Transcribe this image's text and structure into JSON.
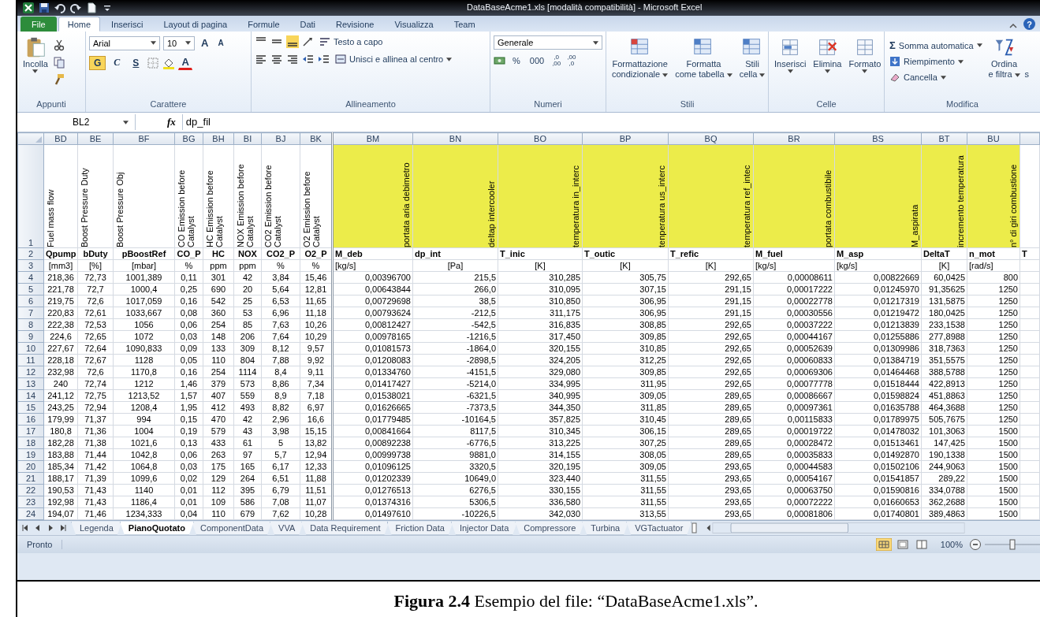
{
  "window": {
    "title": "DataBaseAcme1.xls  [modalità compatibilità]  -  Microsoft Excel"
  },
  "ribbon": {
    "tabs": [
      {
        "label": "File",
        "selected": false,
        "kind": "file"
      },
      {
        "label": "Home",
        "selected": true,
        "kind": "tab"
      },
      {
        "label": "Inserisci",
        "selected": false,
        "kind": "tab"
      },
      {
        "label": "Layout di pagina",
        "selected": false,
        "kind": "tab"
      },
      {
        "label": "Formule",
        "selected": false,
        "kind": "tab"
      },
      {
        "label": "Dati",
        "selected": false,
        "kind": "tab"
      },
      {
        "label": "Revisione",
        "selected": false,
        "kind": "tab"
      },
      {
        "label": "Visualizza",
        "selected": false,
        "kind": "tab"
      },
      {
        "label": "Team",
        "selected": false,
        "kind": "tab"
      }
    ],
    "help": "?",
    "clipboard": {
      "paste": "Incolla",
      "label": "Appunti"
    },
    "font": {
      "name": "Arial",
      "size": "10",
      "grow": "A",
      "shrink": "A",
      "bold": "G",
      "italic": "C",
      "underline": "S",
      "fontcolor": "A",
      "label": "Carattere"
    },
    "alignment": {
      "wrap": "Testo a capo",
      "merge": "Unisci e allinea al centro",
      "label": "Allineamento"
    },
    "number": {
      "format": "Generale",
      "percent": "%",
      "thousands": "000",
      "increase": [
        ",0",
        ",00"
      ],
      "decrease": [
        ",00",
        ",0"
      ],
      "label": "Numeri"
    },
    "styles": {
      "buttons": [
        {
          "lines": [
            "Formattazione",
            "condizionale"
          ]
        },
        {
          "lines": [
            "Formatta",
            "come tabella"
          ]
        },
        {
          "lines": [
            "Stili",
            "cella"
          ]
        }
      ],
      "label": "Stili"
    },
    "cells": {
      "buttons": [
        "Inserisci",
        "Elimina",
        "Formato"
      ],
      "label": "Celle"
    },
    "editing": {
      "sigma": "Σ",
      "autosum": "Somma automatica",
      "fill": "Riempimento",
      "clear": "Cancella",
      "sort": [
        "Ordina",
        "e filtra"
      ],
      "cut": "s",
      "label": "Modifica"
    }
  },
  "formula_bar": {
    "name_box": "BL2",
    "fx": "fx",
    "formula": "dp_fil"
  },
  "sheet": {
    "header_row_numbers": [
      "1",
      "2",
      "3"
    ],
    "columns": [
      {
        "letter": "BD",
        "title": "Fuel mass flow",
        "name": "Qpump",
        "unit": "[mm3]",
        "highlighted": false
      },
      {
        "letter": "BE",
        "title": "Boost Pressure Duty",
        "name": "bDuty",
        "unit": "[%]",
        "highlighted": false
      },
      {
        "letter": "BF",
        "title": "Boost Pressure Obj",
        "name": "pBoostRef",
        "unit": "[mbar]",
        "highlighted": false
      },
      {
        "letter": "BG",
        "title": "CO Emission before Catalyst",
        "name": "CO_P",
        "unit": "%",
        "highlighted": false
      },
      {
        "letter": "BH",
        "title": "HC Emission before Catalyst",
        "name": "HC",
        "unit": "ppm",
        "highlighted": false
      },
      {
        "letter": "BI",
        "title": "NOX Emission before Catalyst",
        "name": "NOX",
        "unit": "ppm",
        "highlighted": false
      },
      {
        "letter": "BJ",
        "title": "CO2 Emission before Catalyst",
        "name": "CO2_P",
        "unit": "%",
        "highlighted": false
      },
      {
        "letter": "BK",
        "title": "O2 Emission before Catalyst",
        "name": "O2_P",
        "unit": "%",
        "highlighted": false
      },
      {
        "letter": "BM",
        "title": "portata aria debimetro",
        "name": "M_deb",
        "unit": "[kg/s]",
        "highlighted": true
      },
      {
        "letter": "BN",
        "title": "deltap intercooler",
        "name": "dp_int",
        "unit": "[Pa]",
        "highlighted": true
      },
      {
        "letter": "BO",
        "title": "temperatura in_interc",
        "name": "T_inic",
        "unit": "[K]",
        "highlighted": true
      },
      {
        "letter": "BP",
        "title": "tenperatura us_interc",
        "name": "T_outic",
        "unit": "[K]",
        "highlighted": true
      },
      {
        "letter": "BQ",
        "title": "temperatura ref_intec",
        "name": "T_refic",
        "unit": "[K]",
        "highlighted": true
      },
      {
        "letter": "BR",
        "title": "portata combustibile",
        "name": "M_fuel",
        "unit": "[kg/s]",
        "highlighted": true
      },
      {
        "letter": "BS",
        "title": "M_aspirata",
        "name": "M_asp",
        "unit": "[kg/s]",
        "highlighted": true
      },
      {
        "letter": "BT",
        "title": "incremento temperatura",
        "name": "DeltaT",
        "unit": "[K]",
        "highlighted": true
      },
      {
        "letter": "BU",
        "title": "n° di giri combustione",
        "name": "n_mot",
        "unit": "[rad/s]",
        "highlighted": true
      },
      {
        "name": "T",
        "highlighted": false
      }
    ],
    "rows": [
      {
        "num": "4",
        "cells": [
          "218,36",
          "72,73",
          "1001,389",
          "0,11",
          "301",
          "42",
          "3,84",
          "15,46",
          "0,00396700",
          "215,5",
          "310,285",
          "305,75",
          "292,65",
          "0,00008611",
          "0,00822669",
          "60,0425",
          "800"
        ]
      },
      {
        "num": "5",
        "cells": [
          "221,78",
          "72,7",
          "1000,4",
          "0,25",
          "690",
          "20",
          "5,64",
          "12,81",
          "0,00643844",
          "266,0",
          "310,095",
          "307,15",
          "291,15",
          "0,00017222",
          "0,01245970",
          "91,35625",
          "1250"
        ]
      },
      {
        "num": "6",
        "cells": [
          "219,75",
          "72,6",
          "1017,059",
          "0,16",
          "542",
          "25",
          "6,53",
          "11,65",
          "0,00729698",
          "38,5",
          "310,850",
          "306,95",
          "291,15",
          "0,00022778",
          "0,01217319",
          "131,5875",
          "1250"
        ]
      },
      {
        "num": "7",
        "cells": [
          "220,83",
          "72,61",
          "1033,667",
          "0,08",
          "360",
          "53",
          "6,96",
          "11,18",
          "0,00793624",
          "-212,5",
          "311,175",
          "306,95",
          "291,15",
          "0,00030556",
          "0,01219472",
          "180,0425",
          "1250"
        ]
      },
      {
        "num": "8",
        "cells": [
          "222,38",
          "72,53",
          "1056",
          "0,06",
          "254",
          "85",
          "7,63",
          "10,26",
          "0,00812427",
          "-542,5",
          "316,835",
          "308,85",
          "292,65",
          "0,00037222",
          "0,01213839",
          "233,1538",
          "1250"
        ]
      },
      {
        "num": "9",
        "cells": [
          "224,6",
          "72,65",
          "1072",
          "0,03",
          "148",
          "206",
          "7,64",
          "10,29",
          "0,00978165",
          "-1216,5",
          "317,450",
          "309,85",
          "292,65",
          "0,00044167",
          "0,01255886",
          "277,8988",
          "1250"
        ]
      },
      {
        "num": "10",
        "cells": [
          "227,67",
          "72,64",
          "1090,833",
          "0,09",
          "133",
          "309",
          "8,12",
          "9,57",
          "0,01081573",
          "-1864,0",
          "320,155",
          "310,85",
          "292,65",
          "0,00052639",
          "0,01309986",
          "318,7363",
          "1250"
        ]
      },
      {
        "num": "11",
        "cells": [
          "228,18",
          "72,67",
          "1128",
          "0,05",
          "110",
          "804",
          "7,88",
          "9,92",
          "0,01208083",
          "-2898,5",
          "324,205",
          "312,25",
          "292,65",
          "0,00060833",
          "0,01384719",
          "351,5575",
          "1250"
        ]
      },
      {
        "num": "12",
        "cells": [
          "232,98",
          "72,6",
          "1170,8",
          "0,16",
          "254",
          "1114",
          "8,4",
          "9,11",
          "0,01334760",
          "-4151,5",
          "329,080",
          "309,85",
          "292,65",
          "0,00069306",
          "0,01464468",
          "388,5788",
          "1250"
        ]
      },
      {
        "num": "13",
        "cells": [
          "240",
          "72,74",
          "1212",
          "1,46",
          "379",
          "573",
          "8,86",
          "7,34",
          "0,01417427",
          "-5214,0",
          "334,995",
          "311,95",
          "292,65",
          "0,00077778",
          "0,01518444",
          "422,8913",
          "1250"
        ]
      },
      {
        "num": "14",
        "cells": [
          "241,12",
          "72,75",
          "1213,52",
          "1,57",
          "407",
          "559",
          "8,9",
          "7,18",
          "0,01538021",
          "-6321,5",
          "340,995",
          "309,05",
          "289,65",
          "0,00086667",
          "0,01598824",
          "451,8863",
          "1250"
        ]
      },
      {
        "num": "15",
        "cells": [
          "243,25",
          "72,94",
          "1208,4",
          "1,95",
          "412",
          "493",
          "8,82",
          "6,97",
          "0,01626665",
          "-7373,5",
          "344,350",
          "311,85",
          "289,65",
          "0,00097361",
          "0,01635788",
          "464,3688",
          "1250"
        ]
      },
      {
        "num": "16",
        "cells": [
          "179,99",
          "71,37",
          "994",
          "0,15",
          "470",
          "42",
          "2,96",
          "16,6",
          "0,01779485",
          "-10164,5",
          "357,825",
          "310,45",
          "289,65",
          "0,00115833",
          "0,01789975",
          "505,7675",
          "1250"
        ]
      },
      {
        "num": "17",
        "cells": [
          "180,8",
          "71,36",
          "1004",
          "0,19",
          "579",
          "43",
          "3,98",
          "15,15",
          "0,00841664",
          "8117,5",
          "310,345",
          "306,15",
          "289,65",
          "0,00019722",
          "0,01478032",
          "101,3063",
          "1500"
        ]
      },
      {
        "num": "18",
        "cells": [
          "182,28",
          "71,38",
          "1021,6",
          "0,13",
          "433",
          "61",
          "5",
          "13,82",
          "0,00892238",
          "-6776,5",
          "313,225",
          "307,25",
          "289,65",
          "0,00028472",
          "0,01513461",
          "147,425",
          "1500"
        ]
      },
      {
        "num": "19",
        "cells": [
          "183,88",
          "71,44",
          "1042,8",
          "0,06",
          "263",
          "97",
          "5,7",
          "12,94",
          "0,00999738",
          "9881,0",
          "314,155",
          "308,05",
          "289,65",
          "0,00035833",
          "0,01492870",
          "190,1338",
          "1500"
        ]
      },
      {
        "num": "20",
        "cells": [
          "185,34",
          "71,42",
          "1064,8",
          "0,03",
          "175",
          "165",
          "6,17",
          "12,33",
          "0,01096125",
          "3320,5",
          "320,195",
          "309,05",
          "293,65",
          "0,00044583",
          "0,01502106",
          "244,9063",
          "1500"
        ]
      },
      {
        "num": "21",
        "cells": [
          "188,17",
          "71,39",
          "1099,6",
          "0,02",
          "129",
          "264",
          "6,51",
          "11,88",
          "0,01202339",
          "10649,0",
          "323,440",
          "311,55",
          "293,65",
          "0,00054167",
          "0,01541857",
          "289,22",
          "1500"
        ]
      },
      {
        "num": "22",
        "cells": [
          "190,53",
          "71,43",
          "1140",
          "0,01",
          "112",
          "395",
          "6,79",
          "11,51",
          "0,01276513",
          "6276,5",
          "330,155",
          "311,55",
          "293,65",
          "0,00063750",
          "0,01590816",
          "334,0788",
          "1500"
        ]
      },
      {
        "num": "23",
        "cells": [
          "192,98",
          "71,43",
          "1186,4",
          "0,01",
          "109",
          "586",
          "7,08",
          "11,07",
          "0,01374316",
          "5306,5",
          "336,580",
          "311,55",
          "293,65",
          "0,00072222",
          "0,01660653",
          "362,2688",
          "1500"
        ]
      },
      {
        "num": "24",
        "cells": [
          "194,07",
          "71,46",
          "1234,333",
          "0,04",
          "110",
          "679",
          "7,62",
          "10,28",
          "0,01497610",
          "-10226,5",
          "342,030",
          "313,55",
          "293,65",
          "0,00081806",
          "0,01740801",
          "389,4863",
          "1500"
        ]
      }
    ]
  },
  "sheet_tabs": [
    {
      "label": "Legenda",
      "selected": false
    },
    {
      "label": "PianoQuotato",
      "selected": true
    },
    {
      "label": "ComponentData",
      "selected": false
    },
    {
      "label": "VVA",
      "selected": false
    },
    {
      "label": "Data Requirement",
      "selected": false
    },
    {
      "label": "Friction Data",
      "selected": false
    },
    {
      "label": "Injector Data",
      "selected": false
    },
    {
      "label": "Compressore",
      "selected": false
    },
    {
      "label": "Turbina",
      "selected": false
    },
    {
      "label": "VGTactuator",
      "selected": false
    }
  ],
  "status_bar": {
    "text": "Pronto",
    "zoom": "100%",
    "zoom_slider": {
      "level": 0.5
    }
  },
  "caption": "**Figura 2.4** Esempio del file: “DataBaseAcme1.xls”."
}
